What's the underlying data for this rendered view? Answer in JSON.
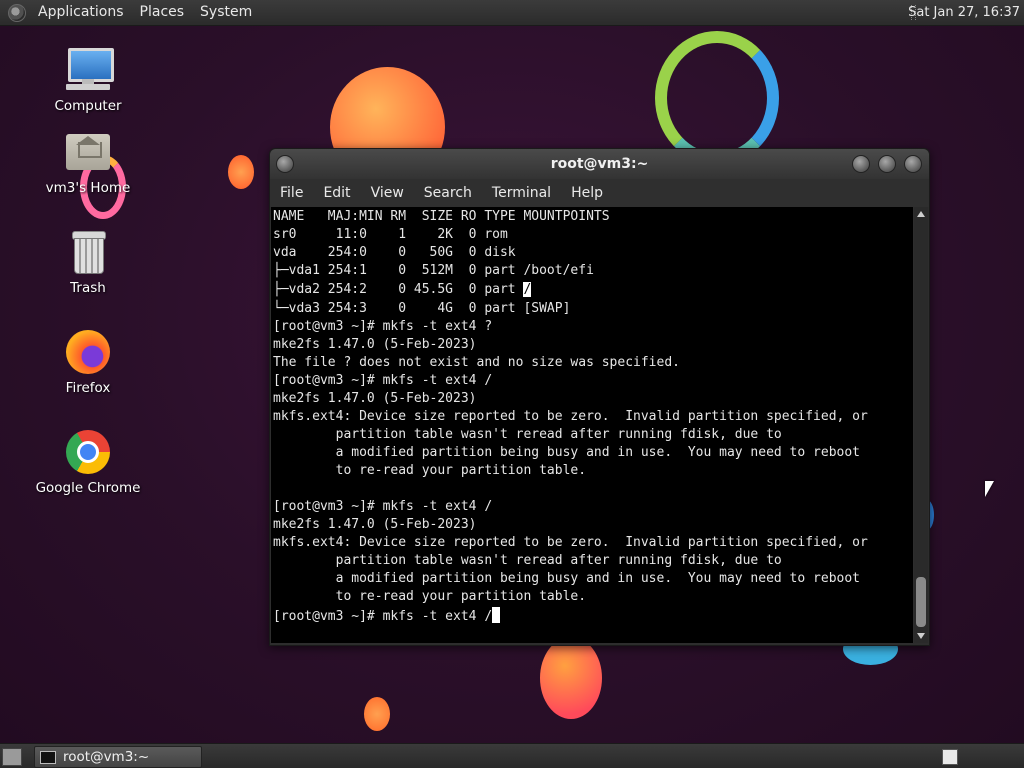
{
  "top_panel": {
    "menus": [
      "Applications",
      "Places",
      "System"
    ],
    "clock": "Sat Jan 27, 16:37"
  },
  "desktop_icons": [
    {
      "label": "Computer",
      "icon": "computer-icon"
    },
    {
      "label": "vm3's Home",
      "icon": "home-folder-icon"
    },
    {
      "label": "Trash",
      "icon": "trash-icon"
    },
    {
      "label": "Firefox",
      "icon": "firefox-icon"
    },
    {
      "label": "Google Chrome",
      "icon": "chrome-icon"
    }
  ],
  "terminal": {
    "title": "root@vm3:~",
    "menu": [
      "File",
      "Edit",
      "View",
      "Search",
      "Terminal",
      "Help"
    ],
    "lines_before_highlight": [
      "NAME   MAJ:MIN RM  SIZE RO TYPE MOUNTPOINTS",
      "sr0     11:0    1    2K  0 rom",
      "vda    254:0    0   50G  0 disk",
      "├─vda1 254:1    0  512M  0 part /boot/efi"
    ],
    "highlight_line_prefix": "├─vda2 254:2    0 45.5G  0 part ",
    "highlight_text": "/",
    "lines_after_highlight": [
      "└─vda3 254:3    0    4G  0 part [SWAP]",
      "[root@vm3 ~]# mkfs -t ext4 ?",
      "mke2fs 1.47.0 (5-Feb-2023)",
      "The file ? does not exist and no size was specified.",
      "[root@vm3 ~]# mkfs -t ext4 /",
      "mke2fs 1.47.0 (5-Feb-2023)",
      "mkfs.ext4: Device size reported to be zero.  Invalid partition specified, or",
      "        partition table wasn't reread after running fdisk, due to",
      "        a modified partition being busy and in use.  You may need to reboot",
      "        to re-read your partition table.",
      "",
      "[root@vm3 ~]# mkfs -t ext4 /",
      "mke2fs 1.47.0 (5-Feb-2023)",
      "mkfs.ext4: Device size reported to be zero.  Invalid partition specified, or",
      "        partition table wasn't reread after running fdisk, due to",
      "        a modified partition being busy and in use.  You may need to reboot",
      "        to re-read your partition table.",
      ""
    ],
    "prompt_line": "[root@vm3 ~]# mkfs -t ext4 /"
  },
  "taskbar": {
    "task_label": "root@vm3:~"
  }
}
